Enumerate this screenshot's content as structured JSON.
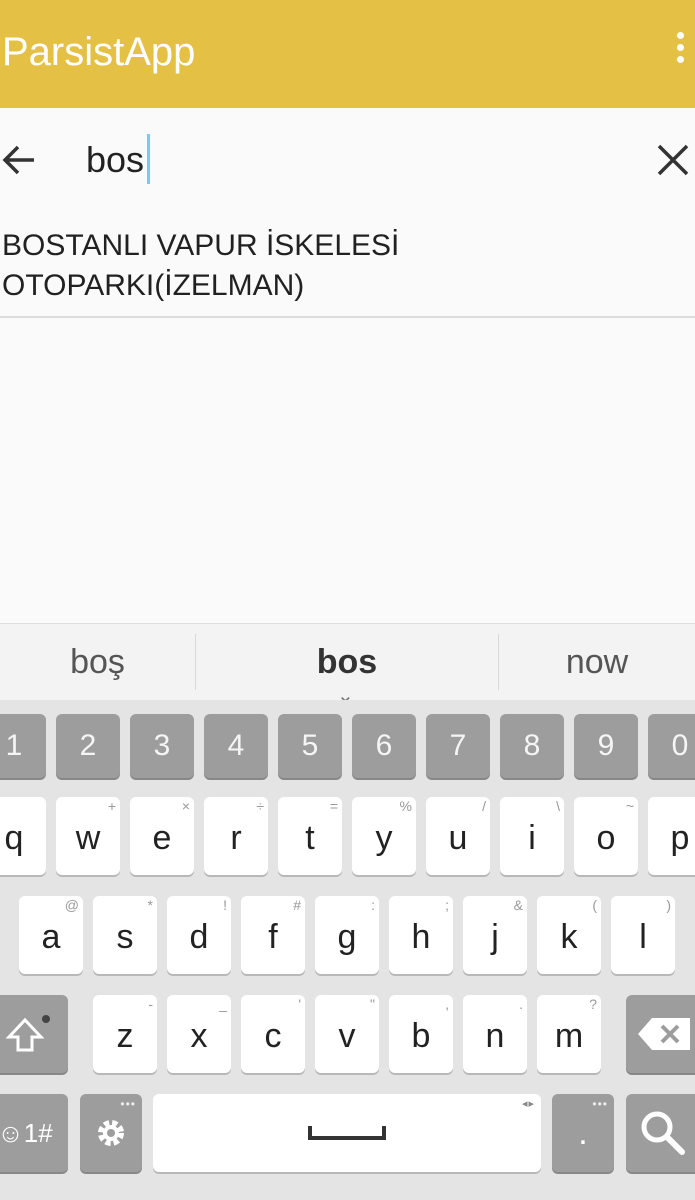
{
  "appbar": {
    "title": "ParsistApp"
  },
  "search": {
    "value": "bos"
  },
  "results": [
    {
      "line1": "BOSTANLI VAPUR İSKELESİ",
      "line2": "OTOPARKI(İZELMAN)"
    }
  ],
  "suggestions": [
    "boş",
    "bos",
    "now"
  ],
  "keyboard": {
    "numbers": [
      "1",
      "2",
      "3",
      "4",
      "5",
      "6",
      "7",
      "8",
      "9",
      "0"
    ],
    "row1": [
      {
        "k": "q",
        "alt": ""
      },
      {
        "k": "w",
        "alt": "+"
      },
      {
        "k": "e",
        "alt": "×"
      },
      {
        "k": "r",
        "alt": "÷"
      },
      {
        "k": "t",
        "alt": "="
      },
      {
        "k": "y",
        "alt": "%"
      },
      {
        "k": "u",
        "alt": "/"
      },
      {
        "k": "i",
        "alt": "\\"
      },
      {
        "k": "o",
        "alt": "~"
      },
      {
        "k": "p",
        "alt": "["
      }
    ],
    "row2": [
      {
        "k": "a",
        "alt": "@"
      },
      {
        "k": "s",
        "alt": "*"
      },
      {
        "k": "d",
        "alt": "!"
      },
      {
        "k": "f",
        "alt": "#"
      },
      {
        "k": "g",
        "alt": ":"
      },
      {
        "k": "h",
        "alt": ";"
      },
      {
        "k": "j",
        "alt": "&"
      },
      {
        "k": "k",
        "alt": "("
      },
      {
        "k": "l",
        "alt": ")"
      }
    ],
    "row3": [
      {
        "k": "z",
        "alt": "-"
      },
      {
        "k": "x",
        "alt": "_"
      },
      {
        "k": "c",
        "alt": "'"
      },
      {
        "k": "v",
        "alt": "\""
      },
      {
        "k": "b",
        "alt": ","
      },
      {
        "k": "n",
        "alt": "."
      },
      {
        "k": "m",
        "alt": "?"
      }
    ],
    "symbols_label": "☺1#",
    "period_label": "."
  },
  "colors": {
    "accent": "#e4c044",
    "caret": "#7cc8f0"
  },
  "icons": [
    "back-arrow-icon",
    "close-icon",
    "overflow-menu-icon",
    "shift-icon",
    "backspace-icon",
    "settings-icon",
    "search-icon"
  ]
}
